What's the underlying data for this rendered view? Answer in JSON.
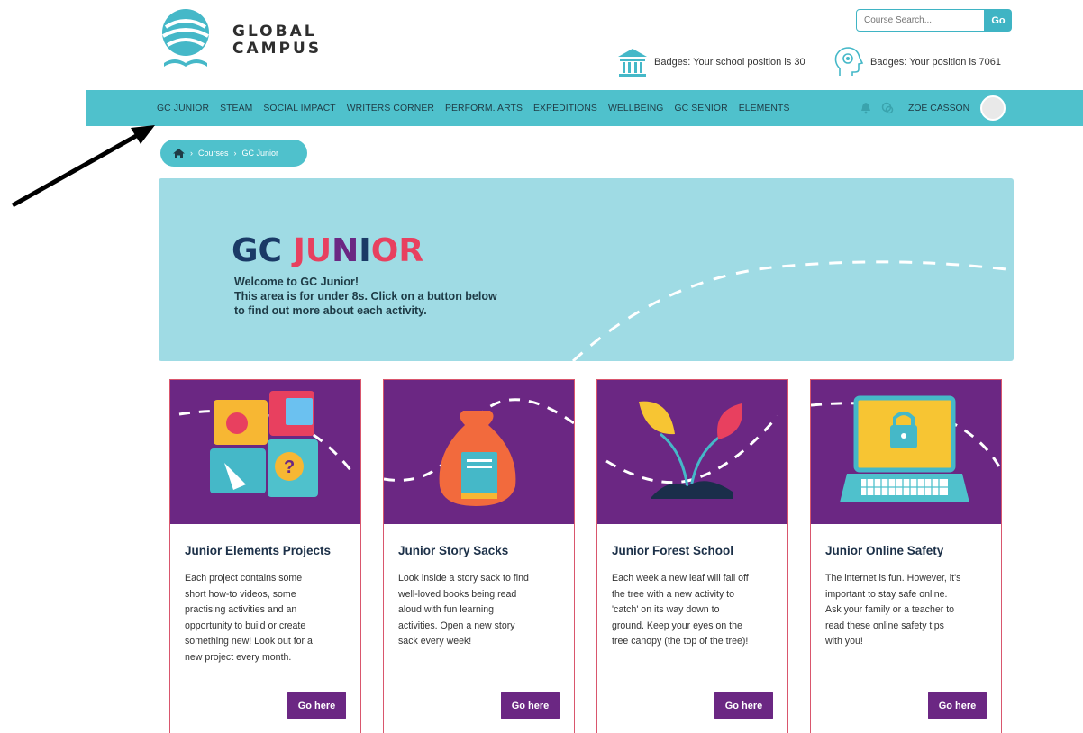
{
  "header": {
    "logo_line1": "GLOBAL",
    "logo_line2": "CAMPUS",
    "search_placeholder": "Course Search...",
    "search_button": "Go",
    "badge_school": "Badges: Your school position is 30",
    "badge_personal": "Badges: Your position is 7061"
  },
  "nav": {
    "items": [
      "GC JUNIOR",
      "STEAM",
      "SOCIAL IMPACT",
      "WRITERS CORNER",
      "PERFORM. ARTS",
      "EXPEDITIONS",
      "WELLBEING",
      "GC SENIOR",
      "ELEMENTS"
    ],
    "user_name": "ZOE CASSON"
  },
  "breadcrumb": {
    "home_icon": "home-icon",
    "items": [
      "Courses",
      "GC Junior"
    ]
  },
  "banner": {
    "title_parts": [
      {
        "text": "GC ",
        "color": "#1a3a66"
      },
      {
        "text": "JU",
        "color": "#e8405f"
      },
      {
        "text": "N",
        "color": "#6b2783"
      },
      {
        "text": "I",
        "color": "#1a3a66"
      },
      {
        "text": "O",
        "color": "#e8405f"
      },
      {
        "text": "R",
        "color": "#e8405f"
      }
    ],
    "line1": "Welcome to GC Junior!",
    "line2": "This area is for under 8s. Click on a button below",
    "line3": "to find out more about each activity."
  },
  "cards": [
    {
      "title": "Junior Elements Projects",
      "lines": [
        "Each project contains some",
        "short how-to videos, some",
        "practising activities and an",
        "opportunity to build or create",
        "something new! Look out for a",
        "new project every month."
      ],
      "button": "Go here",
      "icon": "puzzle-icon"
    },
    {
      "title": "Junior Story Sacks",
      "lines": [
        "Look inside a story sack to find",
        "well-loved books being read",
        "aloud with fun learning",
        "activities.  Open a new story",
        "sack every week!"
      ],
      "button": "Go here",
      "icon": "story-sack-icon"
    },
    {
      "title": "Junior Forest School",
      "lines": [
        "Each week a new leaf will fall off",
        "the tree with a new activity to",
        "'catch' on its way down to",
        "ground. Keep your eyes on the",
        "tree canopy (the top of the tree)!"
      ],
      "button": "Go here",
      "icon": "sapling-icon"
    },
    {
      "title": "Junior Online Safety",
      "lines": [
        "The internet is fun. However, it's",
        "important to stay safe online.",
        "Ask your family or a teacher to",
        "read these online safety tips",
        "with you!"
      ],
      "button": "Go here",
      "icon": "laptop-lock-icon"
    }
  ],
  "colors": {
    "nav": "#4fc1cc",
    "purple": "#6b2783",
    "banner": "#9fdbe4",
    "card_border": "#d9566d"
  }
}
